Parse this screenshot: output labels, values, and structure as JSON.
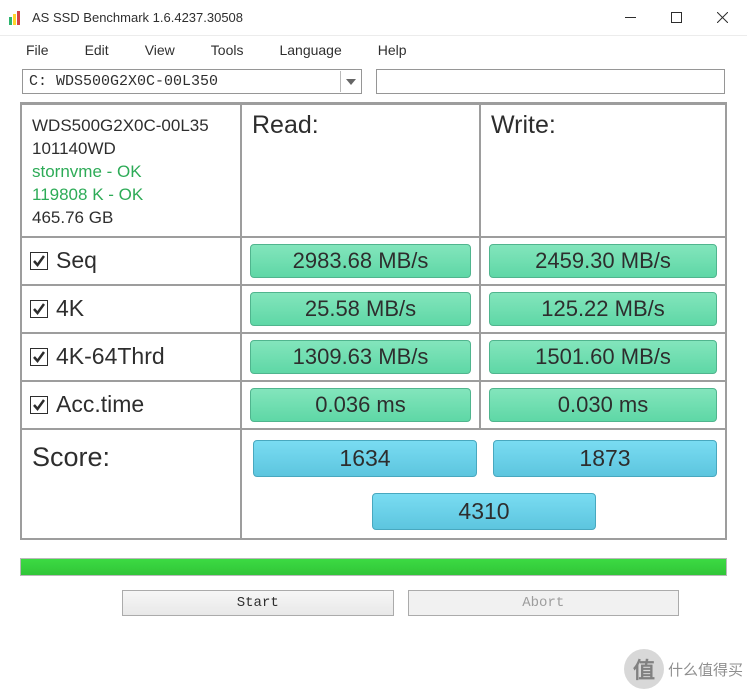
{
  "titlebar": {
    "title": "AS SSD Benchmark 1.6.4237.30508"
  },
  "menu": {
    "file": "File",
    "edit": "Edit",
    "view": "View",
    "tools": "Tools",
    "language": "Language",
    "help": "Help"
  },
  "drive": {
    "selected": "C: WDS500G2X0C-00L350"
  },
  "device": {
    "model": "WDS500G2X0C-00L35",
    "serial": "101140WD",
    "driver_line": "stornvme - OK",
    "align_line": "119808 K - OK",
    "capacity": "465.76 GB"
  },
  "headers": {
    "read": "Read:",
    "write": "Write:",
    "score": "Score:"
  },
  "tests": {
    "seq": {
      "label": "Seq",
      "read": "2983.68 MB/s",
      "write": "2459.30 MB/s"
    },
    "k4": {
      "label": "4K",
      "read": "25.58 MB/s",
      "write": "125.22 MB/s"
    },
    "k4_64": {
      "label": "4K-64Thrd",
      "read": "1309.63 MB/s",
      "write": "1501.60 MB/s"
    },
    "acc": {
      "label": "Acc.time",
      "read": "0.036 ms",
      "write": "0.030 ms"
    }
  },
  "score": {
    "read": "1634",
    "write": "1873",
    "total": "4310"
  },
  "buttons": {
    "start": "Start",
    "abort": "Abort"
  },
  "watermark": {
    "char": "值",
    "text": "什么值得买"
  }
}
